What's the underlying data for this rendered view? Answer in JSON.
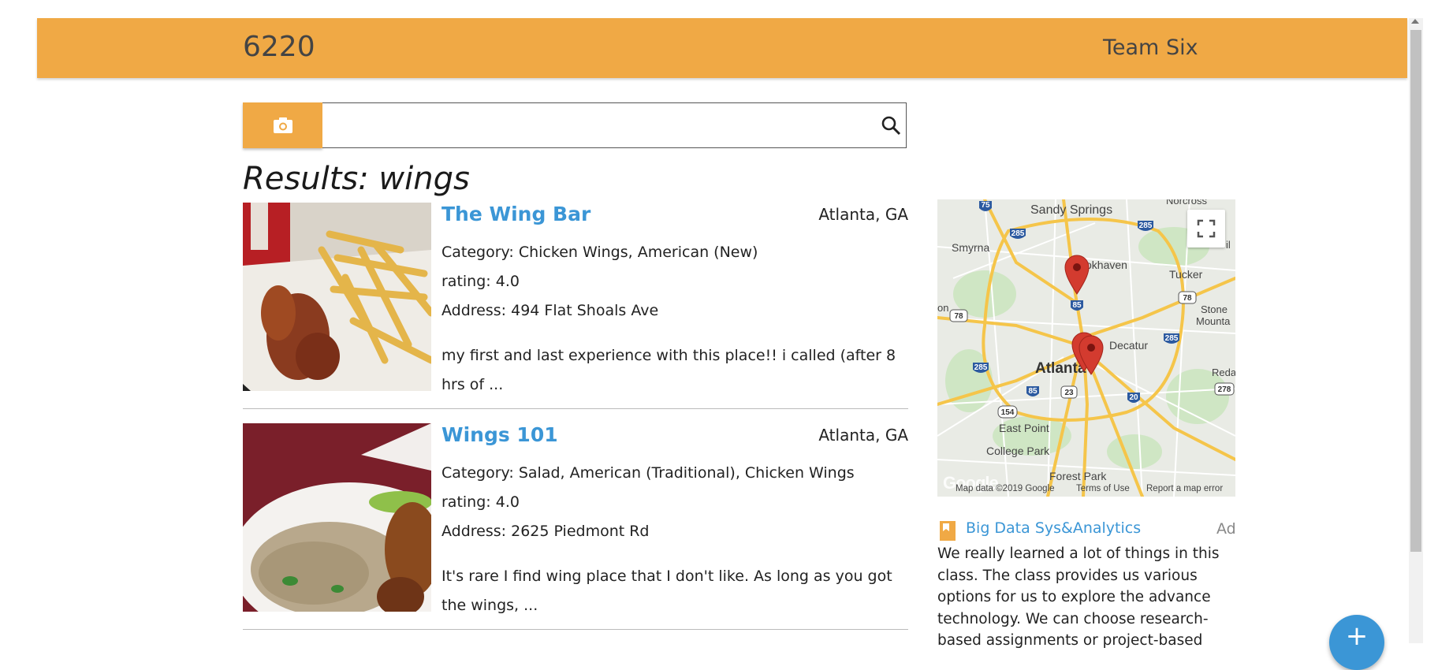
{
  "header": {
    "brand": "6220",
    "team": "Team Six"
  },
  "search": {
    "value": "",
    "placeholder": "",
    "camera_icon": "camera-icon",
    "search_icon": "search-icon"
  },
  "results": {
    "title": "Results: wings",
    "items": [
      {
        "name": "The Wing Bar",
        "location": "Atlanta, GA",
        "category": "Category: Chicken Wings, American (New)",
        "rating": "rating: 4.0",
        "address": "Address: 494 Flat Shoals Ave",
        "snippet": "my first and last experience with this place!! i called (after 8 hrs of ..."
      },
      {
        "name": "Wings 101",
        "location": "Atlanta, GA",
        "category": "Category: Salad, American (Traditional), Chicken Wings",
        "rating": "rating: 4.0",
        "address": "Address: 2625 Piedmont Rd",
        "snippet": "It's rare I find wing place that I don't like. As long as you got the wings, ..."
      }
    ]
  },
  "map": {
    "labels": {
      "sandy_springs": "Sandy Springs",
      "norcross": "Norcross",
      "smyrna": "Smyrna",
      "brookhaven": "okhaven",
      "tucker": "Tucker",
      "stone": "Stone",
      "mounta": "Mounta",
      "decatur": "Decatur",
      "atlanta": "Atlanta",
      "red": "Reda",
      "east_point": "East Point",
      "college_park": "College Park",
      "forest_park": "Forest Park",
      "on": "on",
      "il": "il"
    },
    "shields": [
      "75",
      "285",
      "285",
      "78",
      "85",
      "78",
      "285",
      "285",
      "85",
      "23",
      "20",
      "278",
      "154"
    ],
    "footer": {
      "logo": "Google",
      "data": "Map data ©2019 Google",
      "terms": "Terms of Use",
      "report": "Report a map error"
    }
  },
  "ad": {
    "title": "Big Data Sys&Analytics",
    "badge": "Ad",
    "text": "We really learned a lot of things in this class. The class provides us various options for us to explore the advance technology. We can choose research-based assignments or project-based"
  },
  "fab": {
    "label": "+"
  },
  "colors": {
    "accent": "#f0a945",
    "link": "#3b96d6",
    "pin": "#d33b2f"
  }
}
